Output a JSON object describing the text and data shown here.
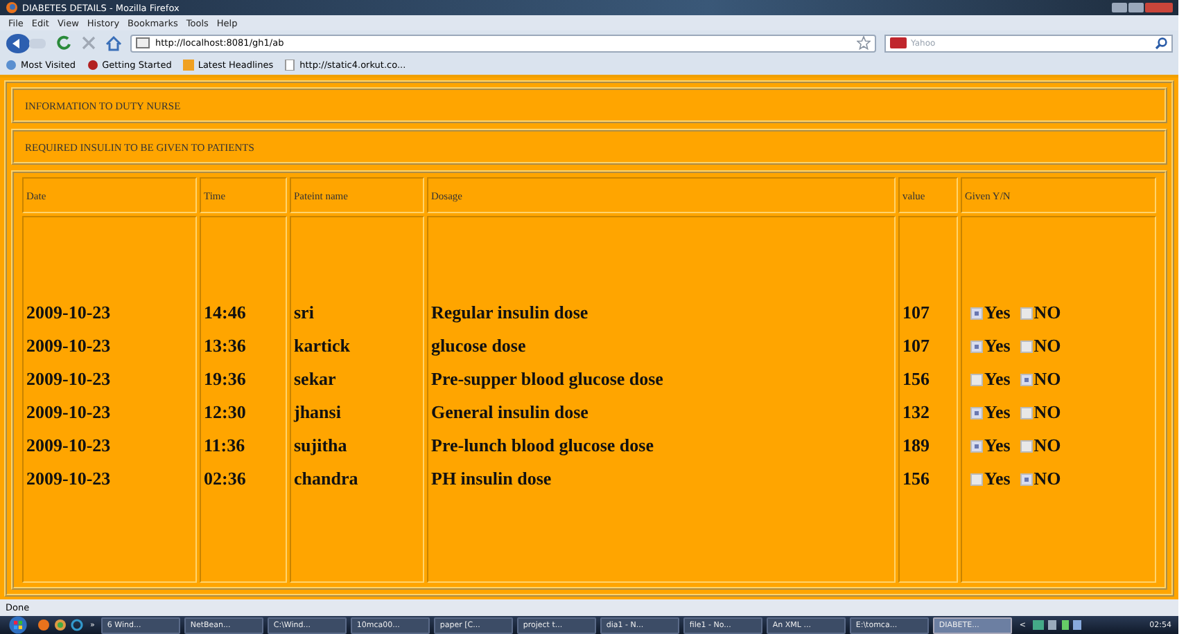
{
  "window": {
    "title": "DIABETES DETAILS - Mozilla Firefox"
  },
  "menu": [
    "File",
    "Edit",
    "View",
    "History",
    "Bookmarks",
    "Tools",
    "Help"
  ],
  "address": {
    "value": "http://localhost:8081/gh1/ab"
  },
  "search": {
    "placeholder": "Yahoo"
  },
  "bookmarks": [
    "Most Visited",
    "Getting Started",
    "Latest Headlines",
    "http://static4.orkut.co..."
  ],
  "page": {
    "heading": "INFORMATION TO DUTY NURSE",
    "subheading": "REQUIRED INSULIN TO BE GIVEN TO PATIENTS"
  },
  "table": {
    "columns": [
      "Date",
      "Time",
      "Pateint name",
      "Dosage",
      "value",
      "Given Y/N"
    ],
    "rows": [
      {
        "date": "2009-10-23",
        "time": "14:46",
        "name": "sri",
        "dosage": "Regular insulin dose",
        "value": "107",
        "yes_label": "Yes",
        "yes_checked": true,
        "no_label": "NO",
        "no_checked": false
      },
      {
        "date": "2009-10-23",
        "time": "13:36",
        "name": "kartick",
        "dosage": "glucose dose",
        "value": "107",
        "yes_label": "Yes",
        "yes_checked": true,
        "no_label": "NO",
        "no_checked": false
      },
      {
        "date": "2009-10-23",
        "time": "19:36",
        "name": "sekar",
        "dosage": "Pre-supper blood glucose dose",
        "value": "156",
        "yes_label": "Yes",
        "yes_checked": false,
        "no_label": "NO",
        "no_checked": true
      },
      {
        "date": "2009-10-23",
        "time": "12:30",
        "name": "jhansi",
        "dosage": "General insulin dose",
        "value": "132",
        "yes_label": "Yes",
        "yes_checked": true,
        "no_label": "NO",
        "no_checked": false
      },
      {
        "date": "2009-10-23",
        "time": "11:36",
        "name": "sujitha",
        "dosage": "Pre-lunch blood glucose dose",
        "value": "189",
        "yes_label": "Yes",
        "yes_checked": true,
        "no_label": "NO",
        "no_checked": false
      },
      {
        "date": "2009-10-23",
        "time": "02:36",
        "name": "chandra",
        "dosage": "PH insulin dose",
        "value": "156",
        "yes_label": "Yes",
        "yes_checked": false,
        "no_label": "NO",
        "no_checked": true
      }
    ]
  },
  "status_bar": {
    "text": "Done"
  },
  "taskbar": {
    "more": "»",
    "tasks": [
      {
        "label": "6 Wind...",
        "selected": false
      },
      {
        "label": "NetBean...",
        "selected": false
      },
      {
        "label": "C:\\Wind...",
        "selected": false
      },
      {
        "label": "10mca00...",
        "selected": false
      },
      {
        "label": "paper [C...",
        "selected": false
      },
      {
        "label": "project t...",
        "selected": false
      },
      {
        "label": "dia1 - N...",
        "selected": false
      },
      {
        "label": "file1 - No...",
        "selected": false
      },
      {
        "label": "An XML ...",
        "selected": false
      },
      {
        "label": "E:\\tomca...",
        "selected": false
      },
      {
        "label": "DIABETE...",
        "selected": true
      }
    ],
    "tray_arrow": "<",
    "clock": "02:54"
  }
}
